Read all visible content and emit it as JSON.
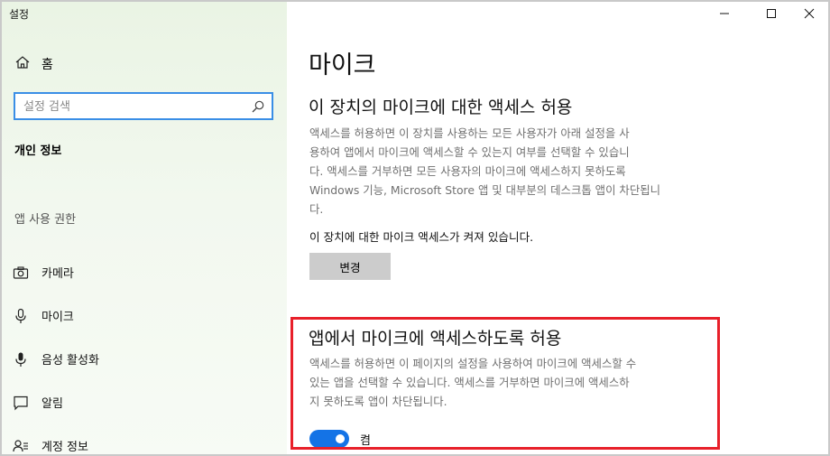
{
  "window": {
    "title": "설정",
    "controls": [
      "minimize",
      "maximize",
      "close"
    ]
  },
  "sidebar": {
    "home_label": "홈",
    "search": {
      "placeholder": "설정 검색",
      "value": ""
    },
    "section_title": "개인 정보",
    "group_label": "앱 사용 권한",
    "items": [
      {
        "label": "카메라",
        "icon": "camera-icon"
      },
      {
        "label": "마이크",
        "icon": "microphone-icon"
      },
      {
        "label": "음성 활성화",
        "icon": "voice-activation-icon"
      },
      {
        "label": "알림",
        "icon": "notification-icon"
      },
      {
        "label": "계정 정보",
        "icon": "account-info-icon"
      }
    ]
  },
  "main": {
    "title": "마이크",
    "device_section": {
      "heading": "이 장치의 마이크에 대한 액세스 허용",
      "description": [
        "액세스를 허용하면 이 장치를 사용하는 모든 사용자가 아래 설정을 사",
        "용하여 앱에서 마이크에 액세스할 수 있는지 여부를 선택할 수 있습니",
        "다. 액세스를 거부하면 모든 사용자의 마이크에 액세스하지 못하도록",
        "Windows 기능, Microsoft Store 앱 및 대부분의 데스크톱 앱이 차단됩니",
        "다."
      ],
      "status_text": "이 장치에 대한 마이크 액세스가 켜져 있습니다.",
      "change_button": "변경"
    },
    "app_section": {
      "heading": "앱에서 마이크에 액세스하도록 허용",
      "description": [
        "액세스를 허용하면 이 페이지의 설정을 사용하여 마이크에 액세스할 수",
        "있는 앱을 선택할 수 있습니다. 액세스를 거부하면 마이크에 액세스하",
        "지 못하도록 앱이 차단됩니다."
      ],
      "toggle_state_label": "켬",
      "toggle_on": true
    }
  },
  "colors": {
    "accent": "#1473e6",
    "highlight_border": "#e8202a",
    "search_border": "#3a8ee6",
    "button_bg": "#cccccc"
  }
}
